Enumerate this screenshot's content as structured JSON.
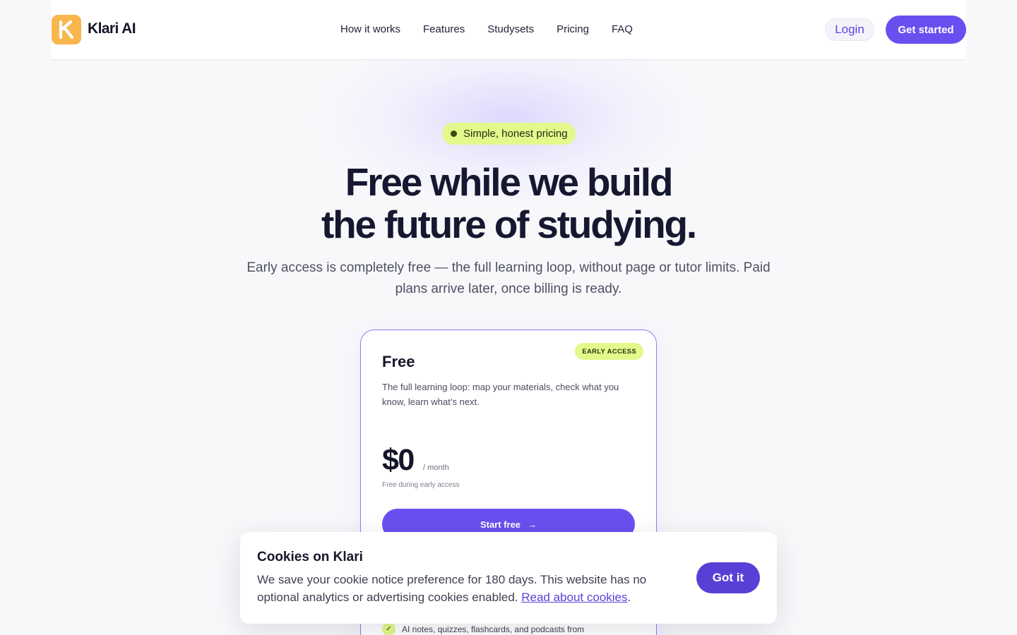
{
  "header": {
    "brand": "Klari AI",
    "logo_letter": "K",
    "nav": [
      "How it works",
      "Features",
      "Studysets",
      "Pricing",
      "FAQ"
    ],
    "login_label": "Login",
    "cta_label": "Get started"
  },
  "hero": {
    "badge": "Simple, honest pricing",
    "title_line1": "Free while we build",
    "title_line2": "the future of studying.",
    "subtitle": "Early access is completely free — the full learning loop, without page or tutor limits. Paid plans arrive later, once billing is ready."
  },
  "plan": {
    "tag": "EARLY ACCESS",
    "name": "Free",
    "description": "The full learning loop: map your materials, check what you know, learn what’s next.",
    "price": "$0",
    "per": "/ month",
    "note": "Free during early access",
    "button_label": "Start free",
    "button_arrow": "→",
    "features": [
      "AI notes, quizzes, flashcards, and podcasts from"
    ]
  },
  "cookie": {
    "title": "Cookies on Klari",
    "text": "We save your cookie notice preference for 180 days. This website has no optional analytics or advertising cookies enabled. ",
    "link_label": "Read about cookies",
    "period": ".",
    "button_label": "Got it"
  },
  "colors": {
    "accent": "#6a4ff0",
    "lime": "#e3f98b",
    "logo": "#f9b64d"
  }
}
